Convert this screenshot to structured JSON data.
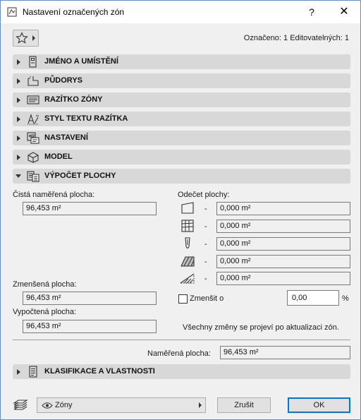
{
  "window": {
    "title": "Nastavení označených zón",
    "help_label": "?",
    "close_label": "✕"
  },
  "header": {
    "selection_info": "Označeno: 1 Editovatelných: 1",
    "favorites_icon": "star-icon"
  },
  "panels": [
    {
      "label": "JMÉNO A UMÍSTĚNÍ",
      "icon": "name-location-icon",
      "expanded": false
    },
    {
      "label": "PŮDORYS",
      "icon": "floor-plan-icon",
      "expanded": false
    },
    {
      "label": "RAZÍTKO ZÓNY",
      "icon": "zone-stamp-icon",
      "expanded": false
    },
    {
      "label": "STYL TEXTU RAZÍTKA",
      "icon": "stamp-text-style-icon",
      "expanded": false
    },
    {
      "label": "NASTAVENÍ",
      "icon": "settings-icon",
      "expanded": false
    },
    {
      "label": "MODEL",
      "icon": "model-icon",
      "expanded": false
    },
    {
      "label": "VÝPOČET PLOCHY",
      "icon": "area-calculation-icon",
      "expanded": true
    }
  ],
  "area": {
    "net_label": "Čistá naměřená plocha:",
    "net_value": "96,453 m²",
    "deduction_label": "Odečet plochy:",
    "deductions": [
      {
        "icon": "low-area-icon",
        "dash": "-",
        "value": "0,000 m²"
      },
      {
        "icon": "columns-grid-icon",
        "dash": "-",
        "value": "0,000 m²"
      },
      {
        "icon": "column-icon",
        "dash": "-",
        "value": "0,000 m²"
      },
      {
        "icon": "fill-hatch-icon",
        "dash": "-",
        "value": "0,000 m²"
      },
      {
        "icon": "sloped-area-icon",
        "dash": "-",
        "value": "0,000 m²"
      }
    ],
    "reduced_label": "Zmenšená plocha:",
    "reduced_value": "96,453 m²",
    "reduce_by_label": "Zmenšit o",
    "reduce_by_value": "0,00",
    "reduce_by_unit": "%",
    "calculated_label": "Vypočtená plocha:",
    "calculated_value": "96,453 m²",
    "note": "Všechny změny se projeví po aktualizaci zón.",
    "measured_label": "Naměřená plocha:",
    "measured_value": "96,453 m²"
  },
  "classification_panel": {
    "label": "KLASIFIKACE A VLASTNOSTI",
    "icon": "classification-icon",
    "expanded": false
  },
  "footer": {
    "layer_value": "Zóny",
    "cancel_label": "Zrušit",
    "ok_label": "OK"
  }
}
